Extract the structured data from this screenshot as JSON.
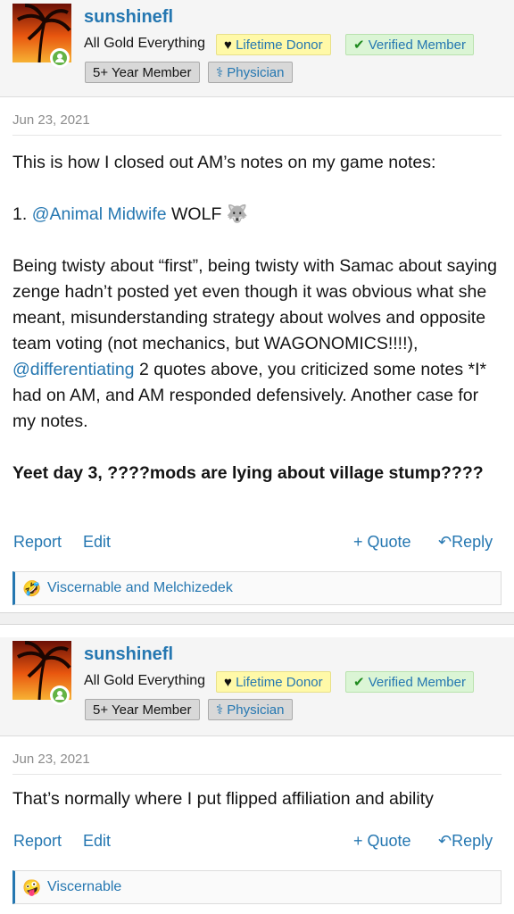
{
  "posts": [
    {
      "username": "sunshinefl",
      "user_title": "All Gold Everything",
      "badges": {
        "donor": "Lifetime Donor",
        "verified": "Verified Member",
        "years": "5+ Year Member",
        "profession": "Physician"
      },
      "date": "Jun 23, 2021",
      "body": {
        "p1": "This is how I closed out AM’s notes on my game notes:",
        "p2_prefix": "1. ",
        "p2_mention": "@Animal Midwife",
        "p2_suffix": " WOLF 🐺",
        "p3_a": "Being twisty about “first”, being twisty with Samac about saying zenge hadn’t posted yet even though it was obvious what she meant, misunderstanding strategy about wolves and opposite team voting (not mechanics, but WAGONOMICS!!!!), ",
        "p3_mention": "@differentiating",
        "p3_b": " 2 quotes above, you criticized some notes *I* had on AM, and AM responded defensively. Another case for my notes.",
        "p4": "Yeet day 3, ????mods are lying about village stump????"
      },
      "actions": {
        "report": "Report",
        "edit": "Edit",
        "quote": "Quote",
        "reply": "Reply"
      },
      "reactions": {
        "emoji": "🤣",
        "names": "Viscernable and Melchizedek"
      }
    },
    {
      "username": "sunshinefl",
      "user_title": "All Gold Everything",
      "badges": {
        "donor": "Lifetime Donor",
        "verified": "Verified Member",
        "years": "5+ Year Member",
        "profession": "Physician"
      },
      "date": "Jun 23, 2021",
      "body": {
        "p1": "That’s normally where I put flipped affiliation and ability"
      },
      "actions": {
        "report": "Report",
        "edit": "Edit",
        "quote": "Quote",
        "reply": "Reply"
      },
      "reactions": {
        "emoji": "🤪",
        "names": "Viscernable"
      }
    }
  ]
}
